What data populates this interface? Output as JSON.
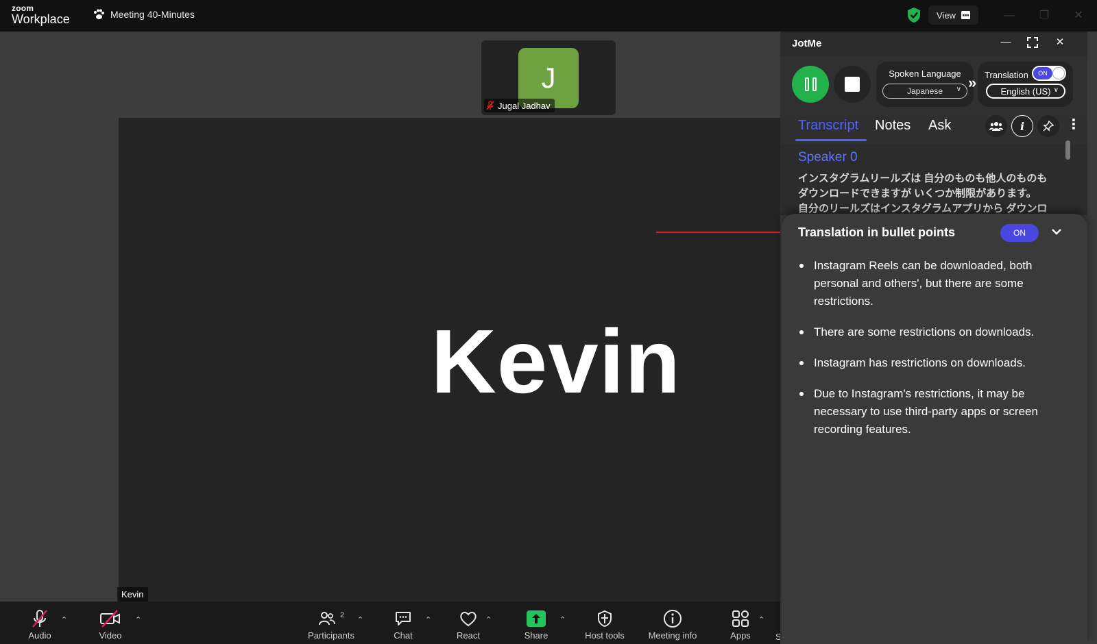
{
  "titlebar": {
    "logo_line1": "zoom",
    "logo_line2": "Workplace",
    "meeting_title": "Meeting 40-Minutes",
    "view_label": "View"
  },
  "stage": {
    "thumbnail": {
      "initial": "J",
      "name": "Jugal Jadhav"
    },
    "main_name": "Kevin",
    "main_label": "Kevin"
  },
  "toolbar": {
    "items": [
      {
        "label": "Audio",
        "icon": "mic-muted-icon"
      },
      {
        "label": "Video",
        "icon": "video-off-icon"
      },
      {
        "label": "Participants",
        "icon": "participants-icon",
        "count": "2"
      },
      {
        "label": "Chat",
        "icon": "chat-icon"
      },
      {
        "label": "React",
        "icon": "heart-icon"
      },
      {
        "label": "Share",
        "icon": "share-icon"
      },
      {
        "label": "Host tools",
        "icon": "shield-icon"
      },
      {
        "label": "Meeting info",
        "icon": "info-icon"
      },
      {
        "label": "Apps",
        "icon": "apps-icon"
      },
      {
        "label": "S",
        "icon": ""
      }
    ]
  },
  "panel": {
    "title": "JotMe",
    "spoken_language_label": "Spoken Language",
    "spoken_language_value": "Japanese",
    "translation_label": "Translation",
    "translation_toggle": "ON",
    "translation_language_value": "English (US)",
    "tabs": [
      "Transcript",
      "Notes",
      "Ask"
    ],
    "active_tab": "Transcript",
    "transcript": {
      "speaker": "Speaker 0",
      "lines": [
        "インスタグラムリールズは 自分のものも他人のものも",
        "ダウンロードできますが いくつか制限があります。",
        "自分のリールズはインスタグラムアプリから ダウンロ"
      ]
    },
    "bullet_card": {
      "title": "Translation in bullet points",
      "toggle": "ON",
      "bullets": [
        "Instagram Reels can be downloaded, both personal and others', but there are some restrictions.",
        "There are some restrictions on downloads.",
        "Instagram has restrictions on downloads.",
        "Due to Instagram's restrictions, it may be necessary to use third-party apps or screen recording features."
      ]
    }
  },
  "colors": {
    "accent_blue": "#4b63ff",
    "toggle_purple": "#4a46e0",
    "record_green": "#22b24c",
    "avatar_green": "#6ea13f",
    "annotation_red": "#e0201c"
  }
}
